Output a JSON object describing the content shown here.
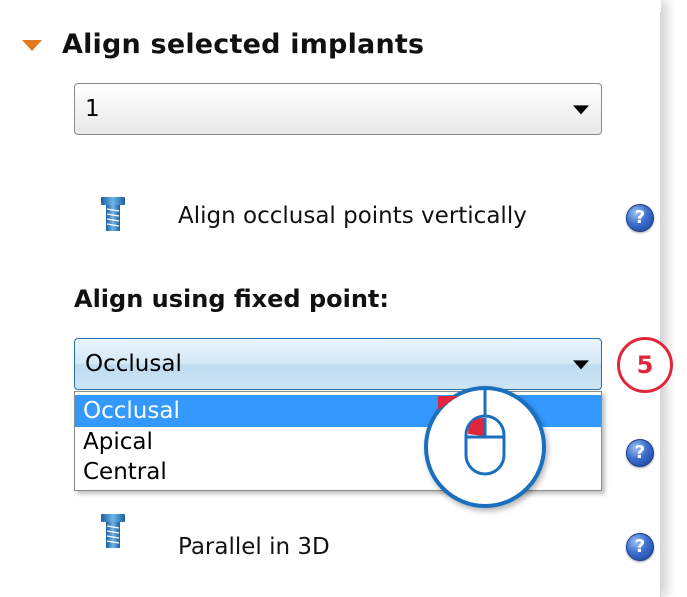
{
  "panel": {
    "header_title": "Align selected implants",
    "implant_select_value": "1",
    "align_occlusal_label": "Align occlusal points vertically",
    "fixed_point_title": "Align using fixed point:",
    "fixed_point_select_value": "Occlusal",
    "fixed_point_options": [
      "Occlusal",
      "Apical",
      "Central"
    ],
    "parallel_label": "Parallel in 3D",
    "help_glyph": "?"
  },
  "callout": {
    "step_number": "5"
  },
  "icons": {
    "section_toggle": "triangle-down-icon",
    "implant": "screw-icon",
    "help": "help-icon",
    "dropdown": "chevron-down-icon",
    "mouse": "mouse-left-click-icon"
  },
  "colors": {
    "accent_orange": "#e07a1c",
    "help_blue": "#3c6fcf",
    "selection_blue": "#3399ff",
    "callout_red": "#e0263a",
    "callout_blue": "#1a6fbf"
  }
}
